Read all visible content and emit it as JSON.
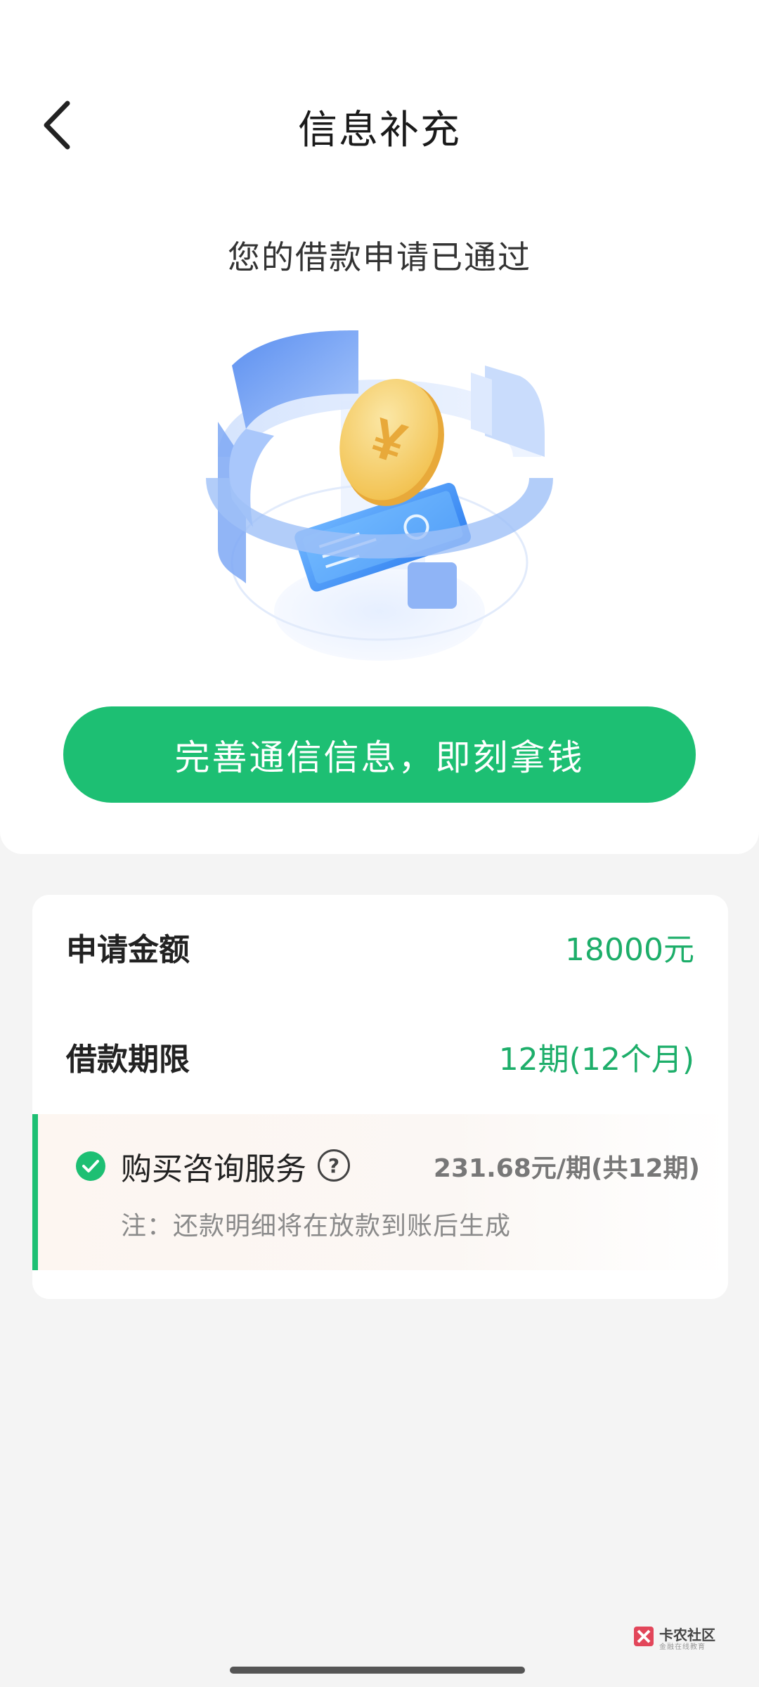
{
  "header": {
    "title": "信息补充",
    "back_icon": "chevron-left-icon"
  },
  "top_card": {
    "approved_text": "您的借款申请已通过",
    "illustration": "coin-phone-ring-illustration",
    "cta_label": "完善通信信息，即刻拿钱"
  },
  "info": {
    "amount_label": "申请金额",
    "amount_value": "18000元",
    "term_label": "借款期限",
    "term_value": "12期(12个月)",
    "service_label": "购买咨询服务",
    "help_symbol": "?",
    "service_price": "231.68元/期(共12期)",
    "note": "注：还款明细将在放款到账后生成"
  },
  "watermark": {
    "title": "卡农社区",
    "subtitle": "金融在线教育"
  },
  "colors": {
    "accent": "#1dbf73",
    "value_green": "#1dae6a",
    "background": "#f4f4f4"
  }
}
